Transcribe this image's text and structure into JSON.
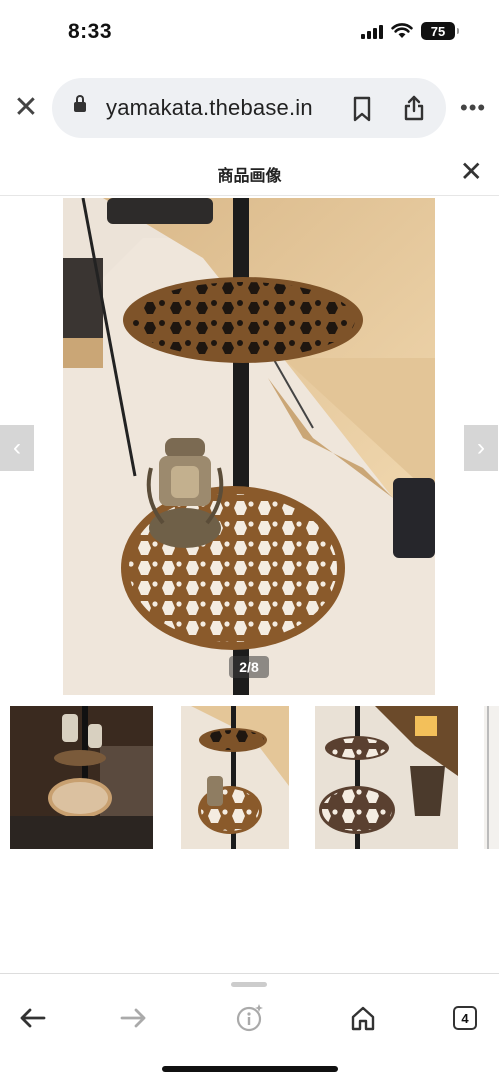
{
  "status_bar": {
    "time": "8:33",
    "battery": "75",
    "icons": [
      "signal-icon",
      "wifi-icon",
      "battery-icon"
    ]
  },
  "browser": {
    "url": "yamakata.thebase.in",
    "icons": [
      "close-tab-icon",
      "lock-icon",
      "bookmark-icon",
      "share-icon",
      "more-icon"
    ]
  },
  "modal": {
    "title": "商品画像",
    "close_icon": "close-icon"
  },
  "gallery": {
    "counter": "2/8",
    "current_index": 2,
    "total": 8,
    "prev_icon": "chevron-left-icon",
    "next_icon": "chevron-right-icon",
    "thumbnails_visible": 4
  },
  "toolbar": {
    "tabs_count": "4",
    "icons": [
      "back-icon",
      "forward-icon",
      "info-sparkle-icon",
      "home-icon",
      "tabs-icon"
    ]
  },
  "colors": {
    "tent": "#e9cfa3",
    "snow": "#efe5da",
    "table_wood": "#8a5a2b",
    "nav_arrow": "#d6d6d6"
  }
}
